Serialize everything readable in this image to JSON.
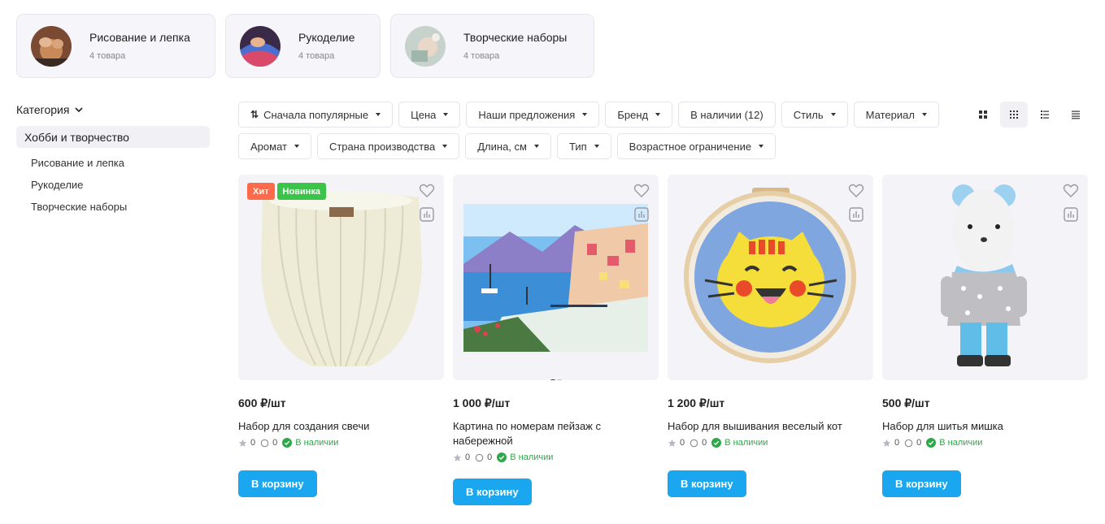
{
  "categories_top": [
    {
      "title": "Рисование и лепка",
      "count": "4 товара"
    },
    {
      "title": "Рукоделие",
      "count": "4 товара"
    },
    {
      "title": "Творческие наборы",
      "count": "4 товара"
    }
  ],
  "sidebar": {
    "heading": "Категория",
    "active": "Хобби и творчество",
    "items": [
      "Рисование и лепка",
      "Рукоделие",
      "Творческие наборы"
    ]
  },
  "filters": {
    "sort": "Сначала популярные",
    "chips": [
      "Цена",
      "Наши предложения",
      "Бренд",
      "Стиль",
      "Материал",
      "Аромат",
      "Страна производства",
      "Длина, см",
      "Тип",
      "Возрастное ограничение"
    ],
    "in_stock": "В наличии (12)"
  },
  "products": [
    {
      "price": "600 ₽/шт",
      "name": "Набор для создания свечи",
      "rating": "0",
      "reviews": "0",
      "stock": "В наличии",
      "badges": [
        "Хит",
        "Новинка"
      ],
      "button": "В корзину"
    },
    {
      "price": "1 000 ₽/шт",
      "name": "Картина по номерам пейзаж с набережной",
      "rating": "0",
      "reviews": "0",
      "stock": "В наличии",
      "badges": [],
      "button": "В корзину"
    },
    {
      "price": "1 200 ₽/шт",
      "name": "Набор для вышивания веселый кот",
      "rating": "0",
      "reviews": "0",
      "stock": "В наличии",
      "badges": [],
      "button": "В корзину"
    },
    {
      "price": "500 ₽/шт",
      "name": "Набор для шитья мишка",
      "rating": "0",
      "reviews": "0",
      "stock": "В наличии",
      "badges": [],
      "button": "В корзину"
    }
  ],
  "colors": {
    "accent": "#1aa7ef",
    "hit": "#ff6b4a",
    "new": "#3cc44a",
    "stock": "#2ea84a"
  }
}
